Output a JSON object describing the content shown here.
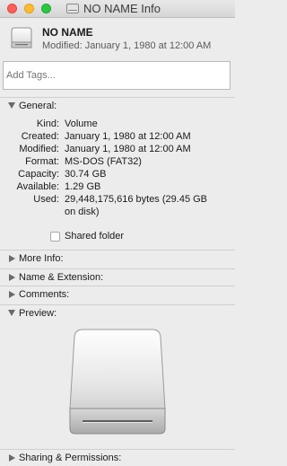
{
  "window": {
    "title": "NO NAME Info"
  },
  "header": {
    "name": "NO NAME",
    "modified": "Modified: January 1, 1980 at 12:00 AM"
  },
  "tags": {
    "placeholder": "Add Tags..."
  },
  "general": {
    "label": "General:",
    "rows": [
      {
        "key": "Kind:",
        "value": "Volume"
      },
      {
        "key": "Created:",
        "value": "January 1, 1980 at 12:00 AM"
      },
      {
        "key": "Modified:",
        "value": "January 1, 1980 at 12:00 AM"
      },
      {
        "key": "Format:",
        "value": "MS-DOS (FAT32)"
      },
      {
        "key": "Capacity:",
        "value": "30.74 GB"
      },
      {
        "key": "Available:",
        "value": "1.29 GB"
      },
      {
        "key": "Used:",
        "value": "29,448,175,616 bytes (29.45 GB",
        "value2": "on disk)"
      }
    ],
    "shared_folder": "Shared folder"
  },
  "sections": {
    "more_info": "More Info:",
    "name_extension": "Name & Extension:",
    "comments": "Comments:",
    "preview": "Preview:",
    "sharing": "Sharing & Permissions:"
  },
  "icons": {
    "drive": "external-drive-icon",
    "disclosure": "disclosure-triangle-icon"
  }
}
